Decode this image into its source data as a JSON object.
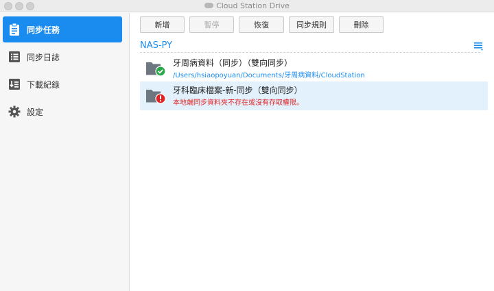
{
  "window": {
    "title": "Cloud Station Drive"
  },
  "sidebar": {
    "items": [
      {
        "label": "同步任務",
        "icon": "clipboard-icon",
        "active": true
      },
      {
        "label": "同步日誌",
        "icon": "list-icon",
        "active": false
      },
      {
        "label": "下載紀錄",
        "icon": "download-log-icon",
        "active": false
      },
      {
        "label": "設定",
        "icon": "gear-icon",
        "active": false
      }
    ]
  },
  "toolbar": {
    "new_label": "新增",
    "pause_label": "暫停",
    "resume_label": "恢復",
    "sync_rules_label": "同步規則",
    "delete_label": "刪除"
  },
  "server": {
    "name": "NAS-PY"
  },
  "tasks": [
    {
      "name": "牙周病資料（同步）（雙向同步）",
      "subtitle": "/Users/hsiaopoyuan/Documents/牙周病資料/CloudStation",
      "status": "ok"
    },
    {
      "name": "牙科臨床檔案-新-同步（雙向同步）",
      "subtitle": "本地端同步資料夾不存在或沒有存取權限。",
      "status": "error"
    }
  ],
  "colors": {
    "accent": "#1a8cf0",
    "error": "#e02424",
    "ok": "#2aa84a",
    "folder": "#6e7780"
  }
}
